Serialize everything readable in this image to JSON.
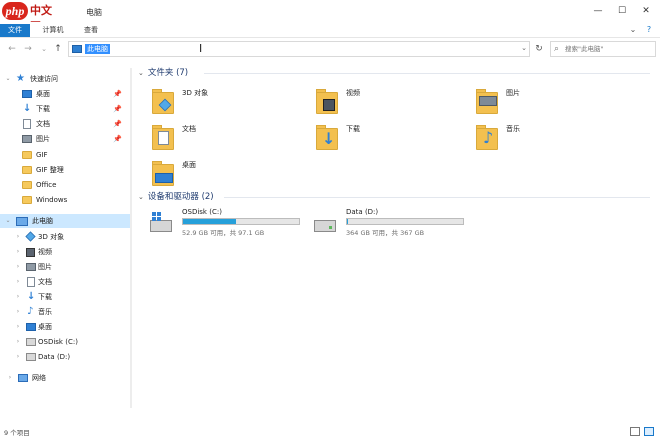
{
  "window": {
    "logo_text": "php",
    "logo_cn": "中文网",
    "title_suffix": "电脑",
    "controls": {
      "minimize": "—",
      "maximize": "☐",
      "close": "✕"
    }
  },
  "ribbon": {
    "tabs": [
      {
        "label": "文件",
        "active": true
      },
      {
        "label": "计算机",
        "active": false
      },
      {
        "label": "查看",
        "active": false
      }
    ],
    "collapse_glyph": "⌄",
    "help_glyph": "?"
  },
  "address": {
    "back": "←",
    "forward": "→",
    "recent": "⌄",
    "up": "↑",
    "path": "此电脑",
    "dropdown": "⌄",
    "refresh": "↻",
    "search_placeholder": "搜索\"此电脑\""
  },
  "nav": {
    "quick_access": "快速访问",
    "pinned": [
      {
        "label": "桌面",
        "icon": "desktop-icon",
        "pin": "📌"
      },
      {
        "label": "下载",
        "icon": "download-icon",
        "pin": "📌"
      },
      {
        "label": "文档",
        "icon": "document-icon",
        "pin": "📌"
      },
      {
        "label": "图片",
        "icon": "picture-icon",
        "pin": "📌"
      }
    ],
    "recent_folders": [
      {
        "label": "GIF"
      },
      {
        "label": "GIF 整理"
      },
      {
        "label": "Office"
      },
      {
        "label": "Windows"
      }
    ],
    "this_pc": "此电脑",
    "pc_children": [
      {
        "label": "3D 对象",
        "icon": "3d-objects-icon"
      },
      {
        "label": "视频",
        "icon": "video-icon"
      },
      {
        "label": "图片",
        "icon": "picture-icon"
      },
      {
        "label": "文档",
        "icon": "document-icon"
      },
      {
        "label": "下载",
        "icon": "download-icon"
      },
      {
        "label": "音乐",
        "icon": "music-icon"
      },
      {
        "label": "桌面",
        "icon": "desktop-icon"
      },
      {
        "label": "OSDisk (C:)",
        "icon": "windows-drive-icon"
      },
      {
        "label": "Data (D:)",
        "icon": "drive-icon"
      }
    ],
    "network": "网络"
  },
  "content": {
    "folders_header": "文件夹 (7)",
    "folders": [
      {
        "label": "3D 对象",
        "icon": "3d-objects-icon"
      },
      {
        "label": "视频",
        "icon": "video-icon"
      },
      {
        "label": "图片",
        "icon": "picture-icon"
      },
      {
        "label": "文档",
        "icon": "document-icon"
      },
      {
        "label": "下载",
        "icon": "download-icon"
      },
      {
        "label": "音乐",
        "icon": "music-icon"
      },
      {
        "label": "桌面",
        "icon": "desktop-icon"
      }
    ],
    "drives_header": "设备和驱动器 (2)",
    "drives": [
      {
        "label": "OSDisk (C:)",
        "free_text": "52.9 GB 可用，共 97.1 GB",
        "used_fraction": 0.455,
        "bar_color": "#26a0da"
      },
      {
        "label": "Data (D:)",
        "free_text": "364 GB 可用，共 367 GB",
        "used_fraction": 0.008,
        "bar_color": "#26a0da"
      }
    ]
  },
  "status": {
    "item_count": "9 个项目"
  }
}
